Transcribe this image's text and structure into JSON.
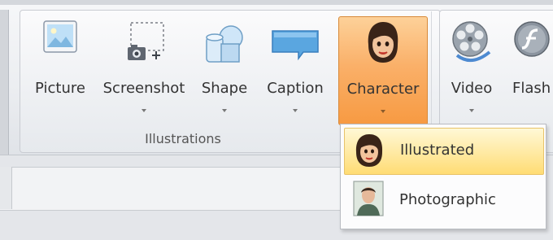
{
  "ribbon": {
    "group_label": "Illustrations",
    "buttons": [
      {
        "label": "Picture",
        "icon": "picture-icon"
      },
      {
        "label": "Screenshot",
        "icon": "screenshot-icon"
      },
      {
        "label": "Shape",
        "icon": "shape-icon"
      },
      {
        "label": "Caption",
        "icon": "caption-icon"
      },
      {
        "label": "Character",
        "icon": "character-icon",
        "active": true
      },
      {
        "label": "Video",
        "icon": "video-reel-icon"
      },
      {
        "label": "Flash",
        "icon": "flash-icon"
      }
    ]
  },
  "dropdown": {
    "items": [
      {
        "label": "Illustrated",
        "icon": "illustrated-character-icon",
        "highlighted": true
      },
      {
        "label": "Photographic",
        "icon": "photographic-character-icon"
      }
    ]
  },
  "colors": {
    "active_button": "#f9a552",
    "highlighted_item": "#ffe08a",
    "ribbon_background": "#eceef1"
  }
}
